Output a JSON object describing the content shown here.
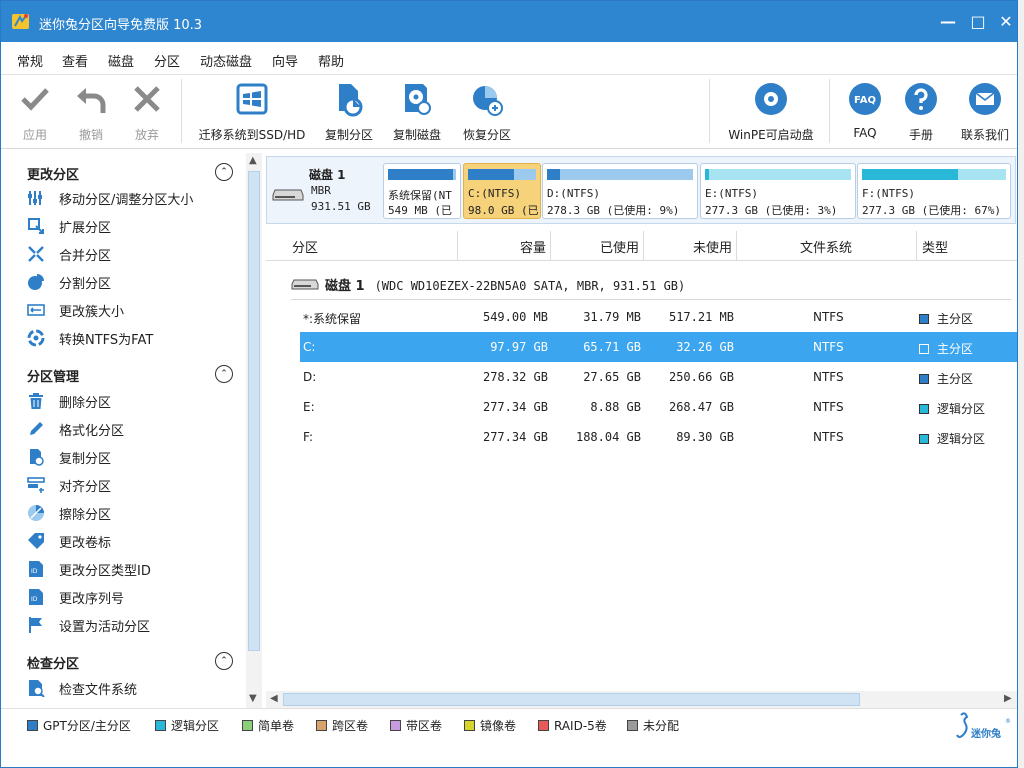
{
  "window": {
    "title": "迷你兔分区向导免费版 10.3",
    "minimize": "—",
    "maximize": "□",
    "close": "✕"
  },
  "menu": [
    "常规",
    "查看",
    "磁盘",
    "分区",
    "动态磁盘",
    "向导",
    "帮助"
  ],
  "toolbar": {
    "apply": "应用",
    "undo": "撤销",
    "discard": "放弃",
    "migrate": "迁移系统到SSD/HD",
    "copy_partition": "复制分区",
    "copy_disk": "复制磁盘",
    "recover_partition": "恢复分区",
    "winpe": "WinPE可启动盘",
    "faq": "FAQ",
    "manual": "手册",
    "contact": "联系我们",
    "faq_icon_text": "FAQ"
  },
  "sidebar": {
    "groups": [
      {
        "title": "更改分区",
        "items": [
          "移动分区/调整分区大小",
          "扩展分区",
          "合并分区",
          "分割分区",
          "更改簇大小",
          "转换NTFS为FAT"
        ]
      },
      {
        "title": "分区管理",
        "items": [
          "删除分区",
          "格式化分区",
          "复制分区",
          "对齐分区",
          "擦除分区",
          "更改卷标",
          "更改分区类型ID",
          "更改序列号",
          "设置为活动分区"
        ]
      },
      {
        "title": "检查分区",
        "items": [
          "检查文件系统"
        ]
      }
    ]
  },
  "diskmap": {
    "name": "磁盘 1",
    "type": "MBR",
    "size": "931.51 GB",
    "partitions": [
      {
        "label": "系统保留(NT",
        "info": "549 MB (已",
        "used_fraction": 0.95,
        "color": "#2e7fc8"
      },
      {
        "label": "C:(NTFS)",
        "info": "98.0 GB (已",
        "used_fraction": 0.67,
        "color": "#2e7fc8"
      },
      {
        "label": "D:(NTFS)",
        "info": "278.3 GB (已使用: 9%)",
        "used_fraction": 0.09,
        "color": "#2e7fc8"
      },
      {
        "label": "E:(NTFS)",
        "info": "277.3 GB (已使用: 3%)",
        "used_fraction": 0.03,
        "color": "#29b8d8"
      },
      {
        "label": "F:(NTFS)",
        "info": "277.3 GB (已使用: 67%)",
        "used_fraction": 0.67,
        "color": "#29b8d8"
      }
    ]
  },
  "table": {
    "headers": [
      "分区",
      "容量",
      "已使用",
      "未使用",
      "文件系统",
      "类型"
    ],
    "disk_label": "磁盘 1",
    "disk_detail": "(WDC WD10EZEX-22BN5A0 SATA, MBR, 931.51 GB)",
    "rows": [
      {
        "partition": "*:系统保留",
        "capacity": "549.00 MB",
        "used": "31.79 MB",
        "unused": "517.21 MB",
        "fs": "NTFS",
        "type": "主分区",
        "type_color": "#2e7fc8"
      },
      {
        "partition": "C:",
        "capacity": "97.97 GB",
        "used": "65.71 GB",
        "unused": "32.26 GB",
        "fs": "NTFS",
        "type": "主分区",
        "type_color": "#2e7fc8"
      },
      {
        "partition": "D:",
        "capacity": "278.32 GB",
        "used": "27.65 GB",
        "unused": "250.66 GB",
        "fs": "NTFS",
        "type": "主分区",
        "type_color": "#2e7fc8"
      },
      {
        "partition": "E:",
        "capacity": "277.34 GB",
        "used": "8.88 GB",
        "unused": "268.47 GB",
        "fs": "NTFS",
        "type": "逻辑分区",
        "type_color": "#29b8d8"
      },
      {
        "partition": "F:",
        "capacity": "277.34 GB",
        "used": "188.04 GB",
        "unused": "89.30 GB",
        "fs": "NTFS",
        "type": "逻辑分区",
        "type_color": "#29b8d8"
      }
    ]
  },
  "legend": [
    {
      "label": "GPT分区/主分区",
      "color": "#2e7fc8"
    },
    {
      "label": "逻辑分区",
      "color": "#29b8d8"
    },
    {
      "label": "简单卷",
      "color": "#8ccf7a"
    },
    {
      "label": "跨区卷",
      "color": "#d8a46a"
    },
    {
      "label": "带区卷",
      "color": "#c79be0"
    },
    {
      "label": "镜像卷",
      "color": "#d6d62a"
    },
    {
      "label": "RAID-5卷",
      "color": "#e85a5a"
    },
    {
      "label": "未分配",
      "color": "#9a9a9a"
    }
  ],
  "brand": {
    "text": "迷你兔",
    "mark": "®"
  },
  "colors": {
    "title_bar": "#2f86d0",
    "selected_row": "#3ba5ef",
    "selected_part": "#f6d27a",
    "primary": "#2e7fc8",
    "logical": "#29b8d8"
  }
}
